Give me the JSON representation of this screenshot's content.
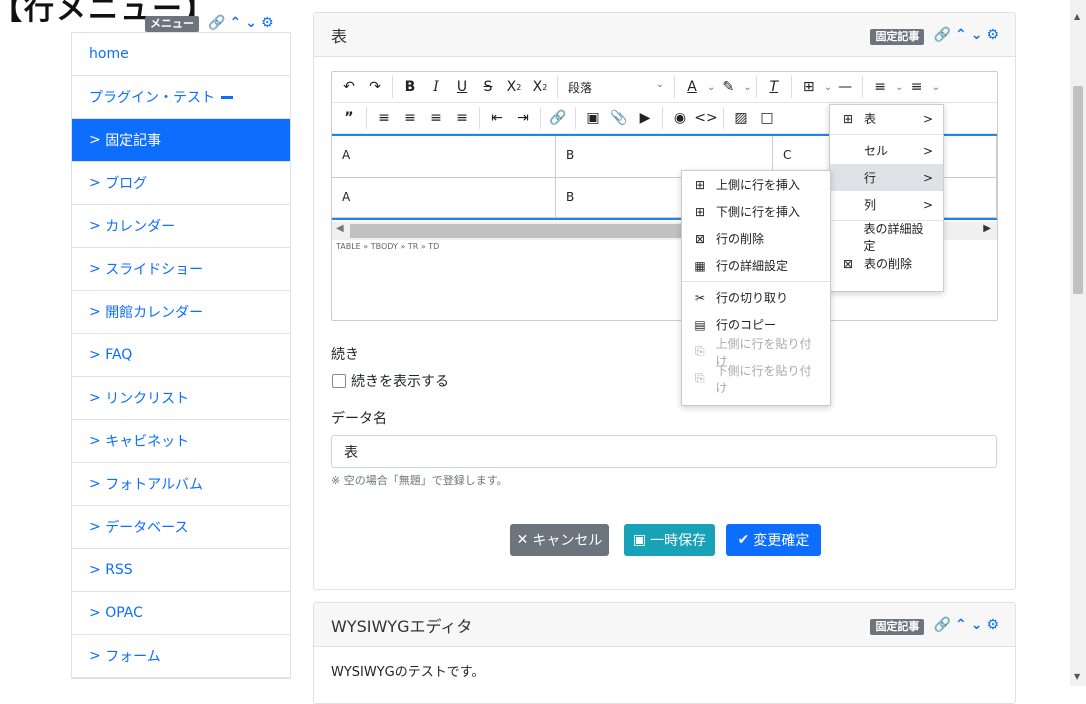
{
  "page": {
    "heading_stub": "【行メニュー】"
  },
  "frame": {
    "menu_badge": "メニュー",
    "fixed_badge": "固定記事"
  },
  "icons": {
    "link": "link-icon",
    "up": "chevron-up-icon",
    "down": "chevron-down-icon",
    "gear": "gear-icon"
  },
  "sidebar": {
    "items": [
      {
        "label": "home"
      },
      {
        "label": "プラグイン・テスト"
      },
      {
        "label": "固定記事"
      },
      {
        "label": "ブログ"
      },
      {
        "label": "カレンダー"
      },
      {
        "label": "スライドショー"
      },
      {
        "label": "開館カレンダー"
      },
      {
        "label": "FAQ"
      },
      {
        "label": "リンクリスト"
      },
      {
        "label": "キャビネット"
      },
      {
        "label": "フォトアルバム"
      },
      {
        "label": "データベース"
      },
      {
        "label": "RSS"
      },
      {
        "label": "OPAC"
      },
      {
        "label": "フォーム"
      }
    ],
    "active_index": 2
  },
  "card1": {
    "title": "表",
    "toolbar": {
      "block_format": "段落",
      "table_icon": "table-icon"
    },
    "table": {
      "rows": [
        [
          "A",
          "B",
          "C"
        ],
        [
          "A",
          "B",
          ""
        ]
      ]
    },
    "statusbar": "TABLE » TBODY » TR » TD",
    "continue_label": "続き",
    "continue_checkbox": "続きを表示する",
    "dataname_label": "データ名",
    "dataname_value": "表",
    "hint": "※ 空の場合「無題」で登録します。",
    "buttons": {
      "cancel": "キャンセル",
      "temp_save": "一時保存",
      "confirm": "変更確定"
    }
  },
  "table_menu": {
    "items": [
      {
        "label": "表",
        "icon": "table-icon",
        "submenu": true
      },
      {
        "label": "セル",
        "submenu": true
      },
      {
        "label": "行",
        "submenu": true,
        "highlighted": true
      },
      {
        "label": "列",
        "submenu": true
      },
      {
        "label": "表の詳細設定"
      },
      {
        "label": "表の削除",
        "icon": "table-delete-icon"
      }
    ]
  },
  "row_menu": {
    "items": [
      {
        "label": "上側に行を挿入",
        "icon": "row-insert-above-icon",
        "disabled": false
      },
      {
        "label": "下側に行を挿入",
        "icon": "row-insert-below-icon",
        "disabled": false
      },
      {
        "label": "行の削除",
        "icon": "row-delete-icon",
        "disabled": false
      },
      {
        "label": "行の詳細設定",
        "icon": "row-properties-icon",
        "disabled": false
      },
      {
        "label": "行の切り取り",
        "icon": "row-cut-icon",
        "disabled": false
      },
      {
        "label": "行のコピー",
        "icon": "row-copy-icon",
        "disabled": false
      },
      {
        "label": "上側に行を貼り付け",
        "icon": "paste-above-icon",
        "disabled": true
      },
      {
        "label": "下側に行を貼り付け",
        "icon": "paste-below-icon",
        "disabled": true
      }
    ]
  },
  "card2": {
    "title": "WYSIWYGエディタ",
    "body": "WYSIWYGのテストです。"
  },
  "colors": {
    "primary": "#0d6efd",
    "secondary": "#6c757d",
    "info": "#17a2b8",
    "border": "#dee2e6"
  }
}
